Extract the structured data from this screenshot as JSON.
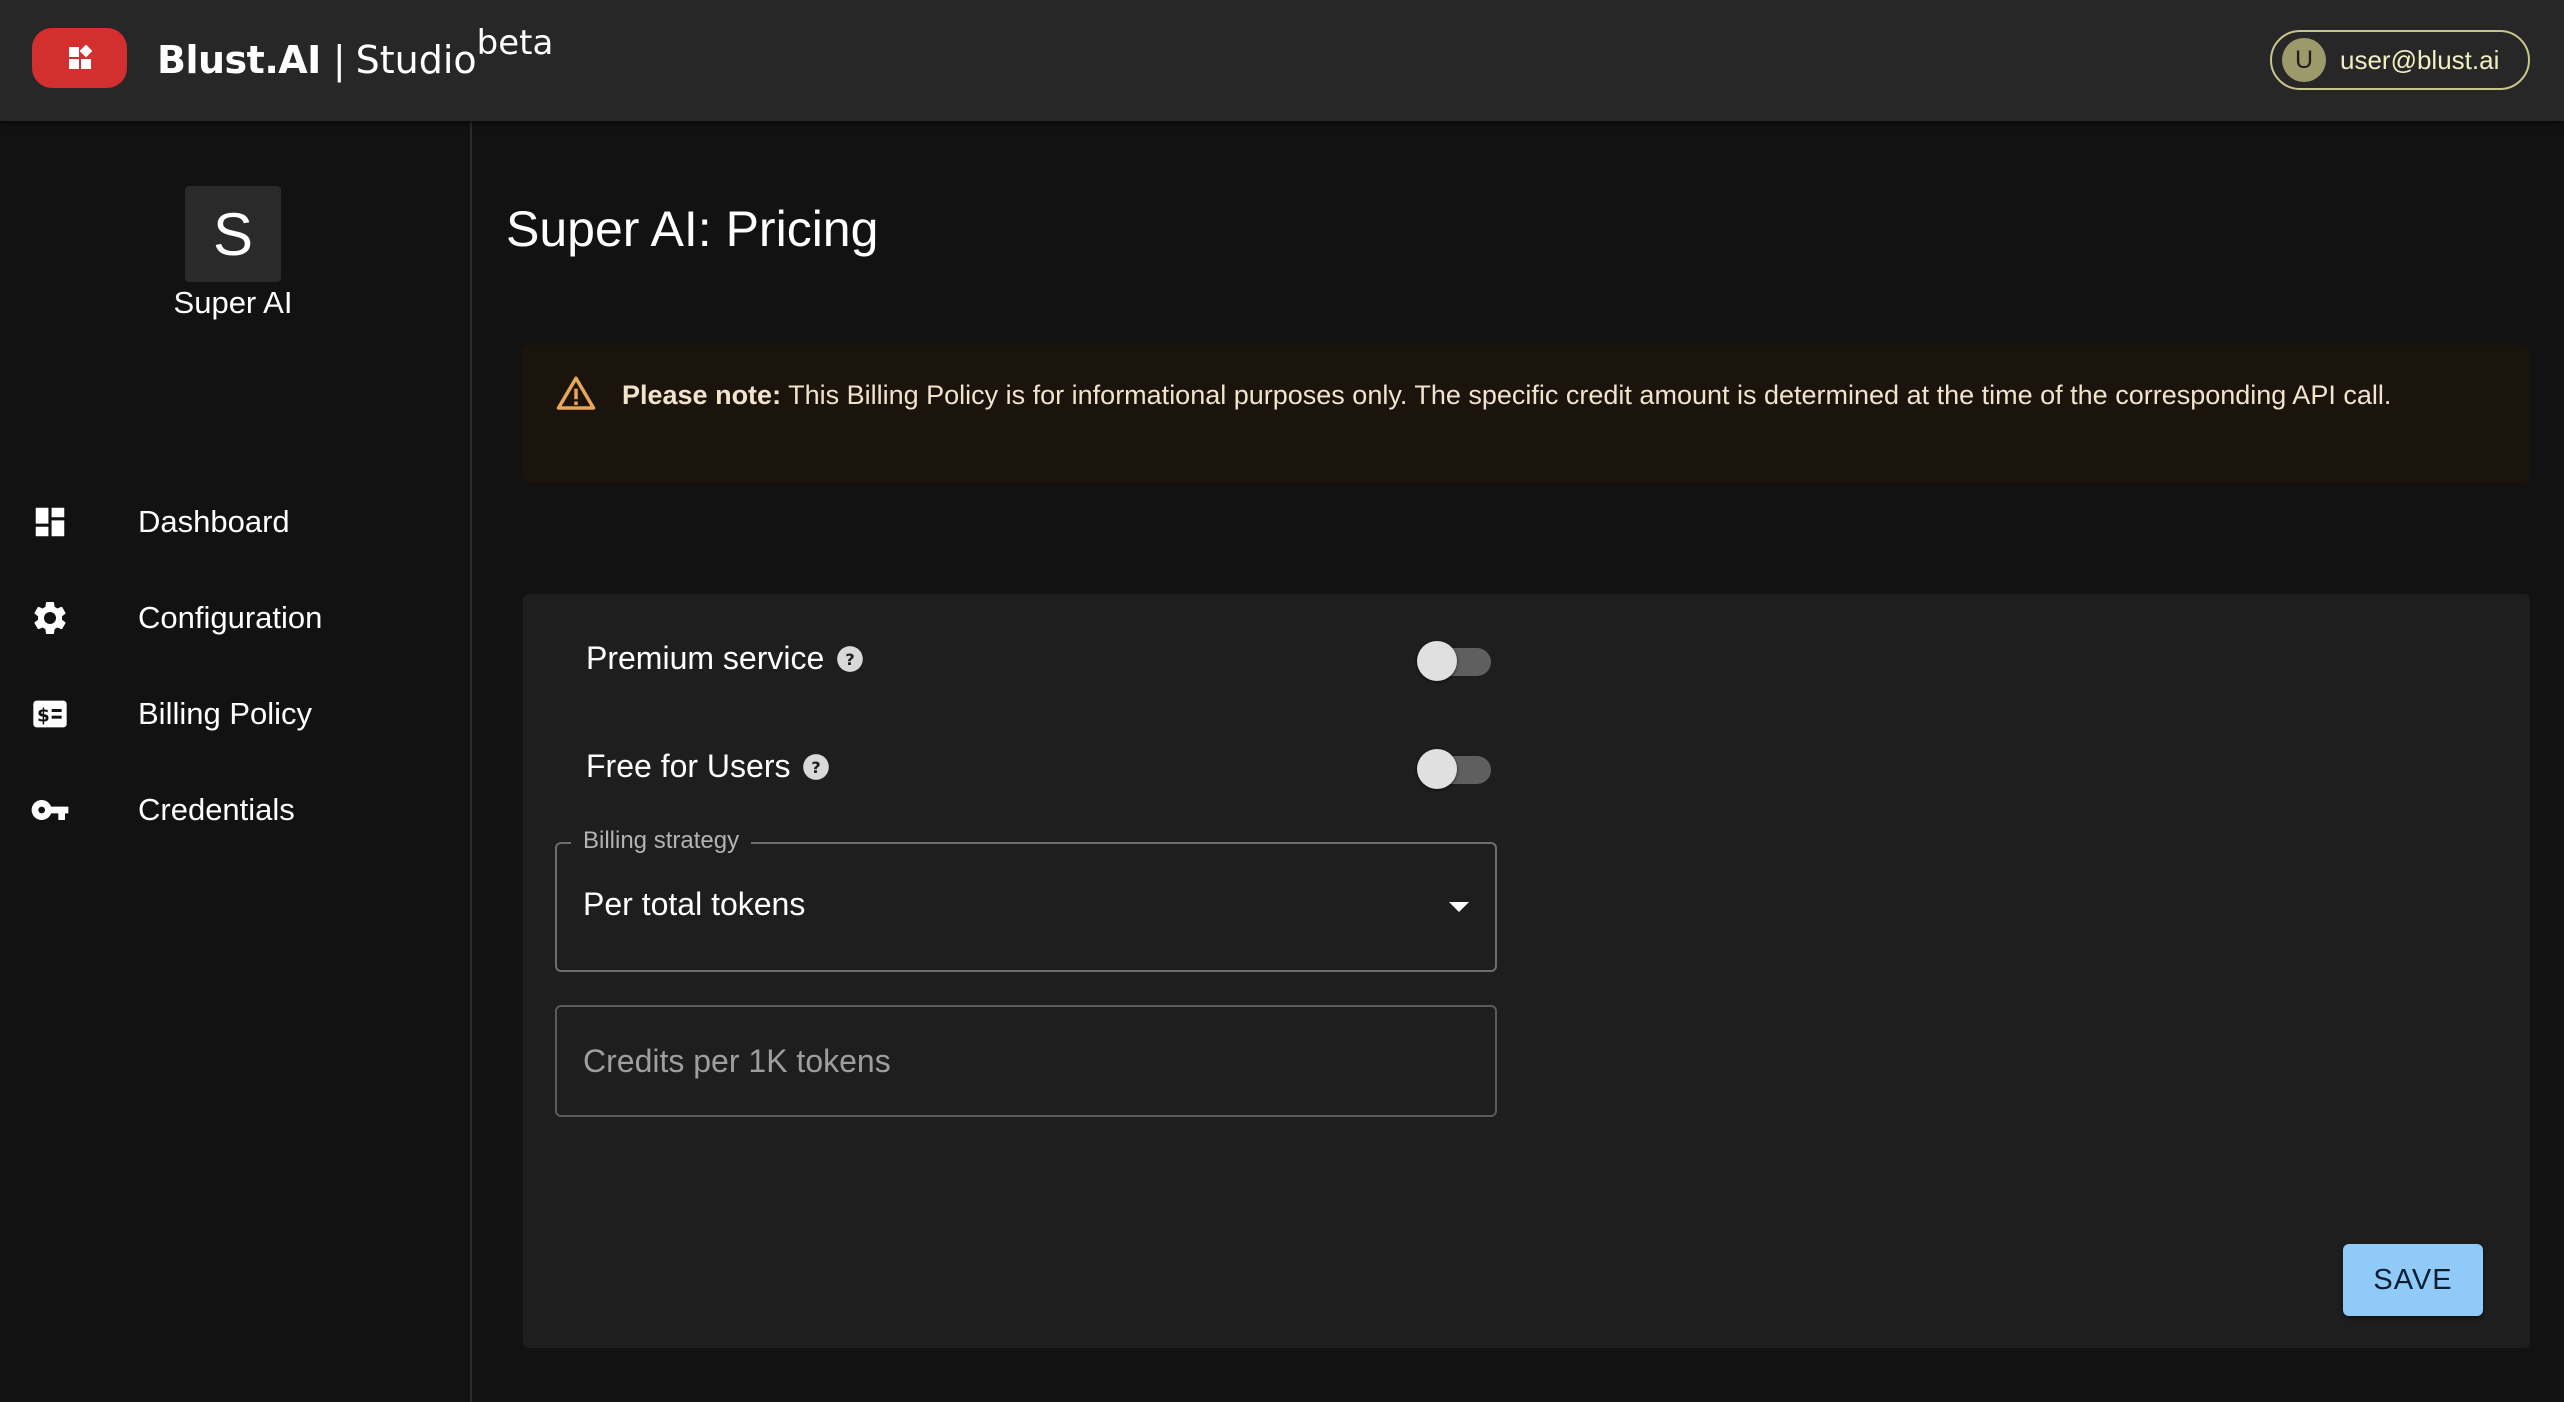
{
  "header": {
    "brand_name": "Blust.AI",
    "brand_separator": "|",
    "brand_product": "Studio",
    "brand_tag": "beta",
    "user": {
      "initial": "U",
      "email": "user@blust.ai"
    }
  },
  "sidebar": {
    "app_initial": "S",
    "app_name": "Super AI",
    "items": [
      {
        "label": "Dashboard",
        "icon": "dashboard-icon"
      },
      {
        "label": "Configuration",
        "icon": "gear-icon"
      },
      {
        "label": "Billing Policy",
        "icon": "billing-icon"
      },
      {
        "label": "Credentials",
        "icon": "key-icon"
      }
    ]
  },
  "main": {
    "title": "Super AI: Pricing",
    "alert": {
      "icon": "warning-icon",
      "bold": "Please note:",
      "text": " This Billing Policy is for informational purposes only. The specific credit amount is determined at the time of the corresponding API call."
    },
    "form": {
      "premium_label": "Premium service",
      "premium_enabled": false,
      "free_label": "Free for Users",
      "free_enabled": false,
      "billing_strategy_label": "Billing strategy",
      "billing_strategy_value": "Per total tokens",
      "credits_placeholder": "Credits per 1K tokens",
      "save_label": "SAVE"
    }
  },
  "colors": {
    "topbar": "#272727",
    "logo": "#d32f2f",
    "background": "#121212",
    "card": "#1e1e1e",
    "alert_bg": "#1b140c",
    "alert_icon": "#e8a657",
    "user_chip_border": "#c9c58a",
    "save_button": "#90caf9"
  }
}
